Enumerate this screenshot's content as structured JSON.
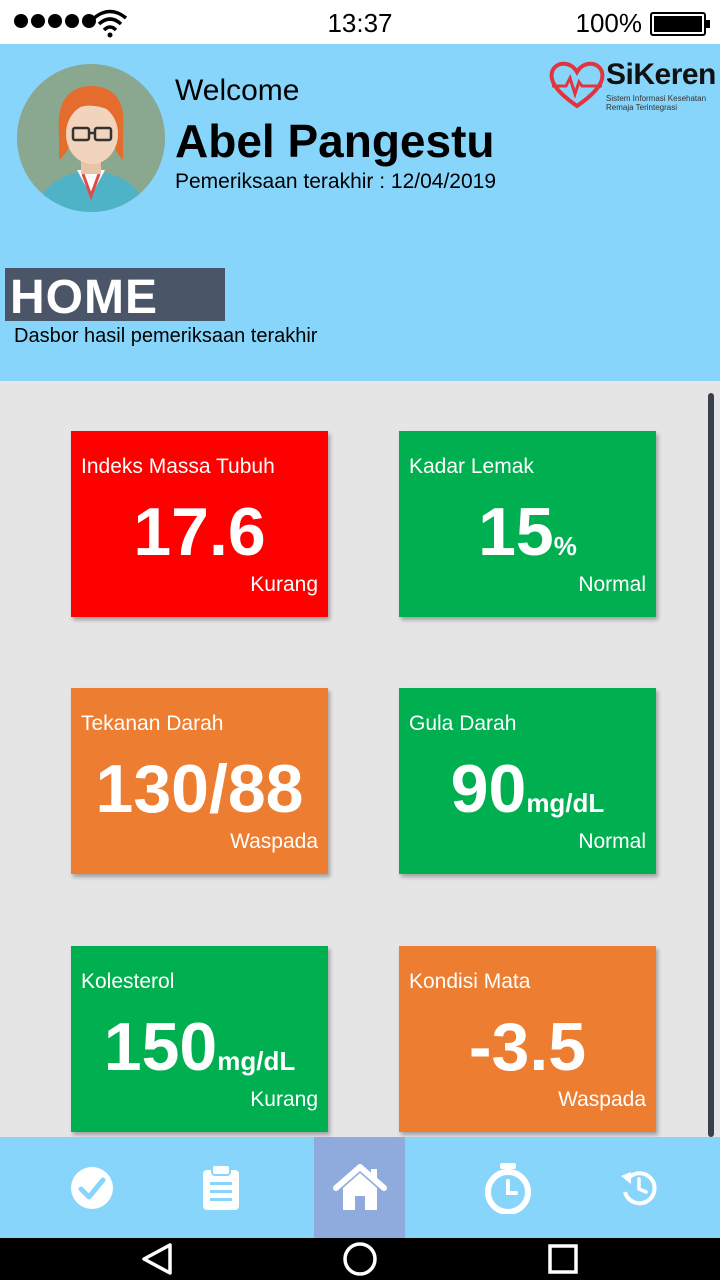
{
  "status_bar": {
    "time": "13:37",
    "battery": "100%"
  },
  "header": {
    "welcome": "Welcome",
    "user_name": "Abel Pangestu",
    "last_check_label": "Pemeriksaan terakhir : 12/04/2019",
    "logo_name": "SiKeren",
    "logo_tagline": "Sistem Informasi Kesehatan Remaja Terintegrasi",
    "page_title": "HOME",
    "page_subtitle": "Dasbor hasil pemeriksaan terakhir"
  },
  "cards": [
    {
      "title": "Indeks Massa Tubuh",
      "value": "17.6",
      "unit": "",
      "status": "Kurang",
      "color": "#fe0000"
    },
    {
      "title": "Kadar Lemak",
      "value": "15",
      "unit": "%",
      "status": "Normal",
      "color": "#00b050"
    },
    {
      "title": "Tekanan Darah",
      "value": "130/88",
      "unit": "",
      "status": "Waspada",
      "color": "#ed7d31"
    },
    {
      "title": "Gula Darah",
      "value": "90",
      "unit": "mg/dL",
      "status": "Normal",
      "color": "#00b050"
    },
    {
      "title": "Kolesterol",
      "value": "150",
      "unit": "mg/dL",
      "status": "Kurang",
      "color": "#00b050"
    },
    {
      "title": "Kondisi Mata",
      "value": "-3.5",
      "unit": "",
      "status": "Waspada",
      "color": "#ed7d31"
    }
  ],
  "nav": {
    "items": [
      {
        "icon": "check-circle-icon"
      },
      {
        "icon": "clipboard-icon"
      },
      {
        "icon": "home-icon",
        "active": true
      },
      {
        "icon": "stopwatch-icon"
      },
      {
        "icon": "history-icon"
      }
    ]
  },
  "colors": {
    "header_bg": "#87d5fb",
    "nav_active": "#8faadc",
    "title_pill": "#4a5568"
  }
}
